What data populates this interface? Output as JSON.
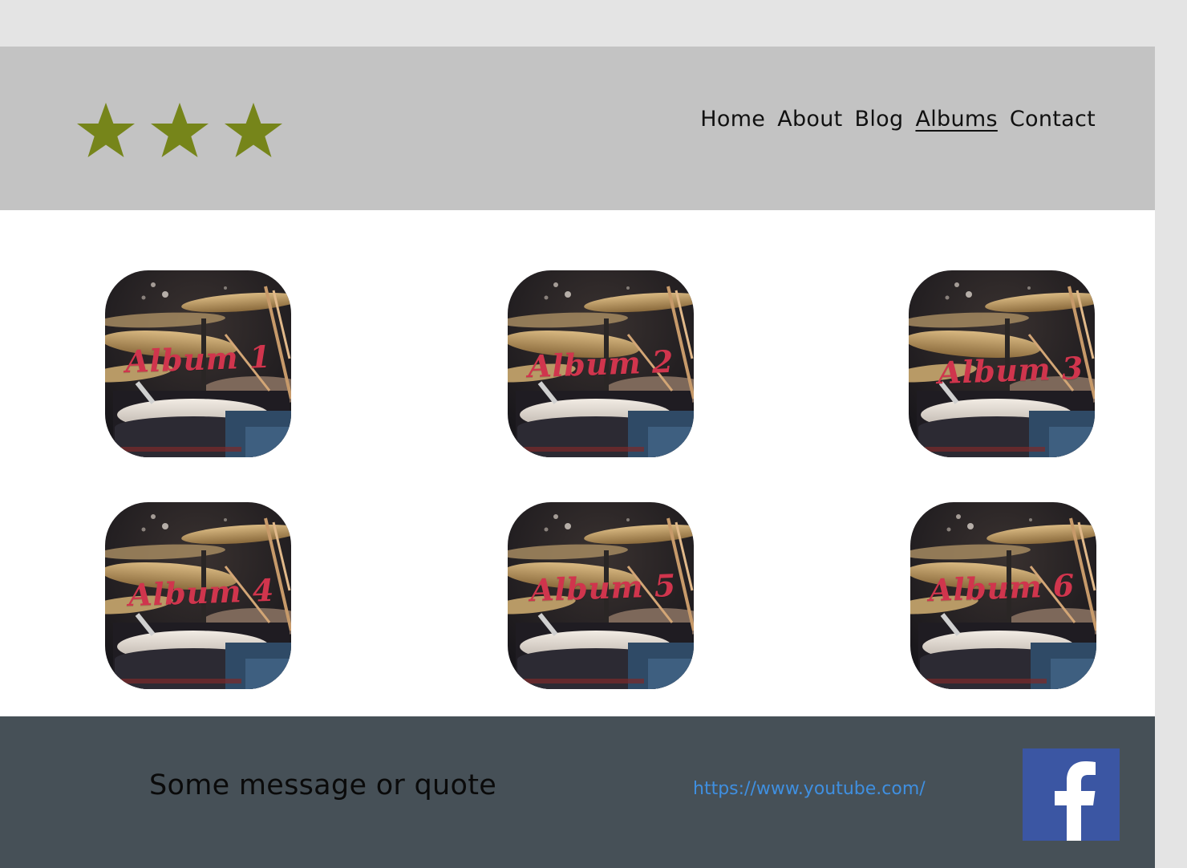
{
  "header": {
    "logo": {
      "stars": 3,
      "icon": "star-icon",
      "color": "#76851a"
    },
    "nav": [
      {
        "label": "Home",
        "active": false
      },
      {
        "label": "About",
        "active": false
      },
      {
        "label": "Blog",
        "active": false
      },
      {
        "label": "Albums",
        "active": true
      },
      {
        "label": "Contact",
        "active": false
      }
    ]
  },
  "albums": [
    {
      "title": "Album 1",
      "image": "drum-kit-photo"
    },
    {
      "title": "Album 2",
      "image": "drum-kit-photo"
    },
    {
      "title": "Album 3",
      "image": "drum-kit-photo"
    },
    {
      "title": "Album 4",
      "image": "drum-kit-photo"
    },
    {
      "title": "Album 5",
      "image": "drum-kit-photo"
    },
    {
      "title": "Album 6",
      "image": "drum-kit-photo"
    }
  ],
  "footer": {
    "quote": "Some message or quote",
    "link_text": "https://www.youtube.com/",
    "social_icon": "facebook-icon",
    "social_color": "#3b56a3"
  },
  "colors": {
    "header_bg": "#c3c3c3",
    "footer_bg": "#465057",
    "album_title": "#d0354d",
    "link": "#3f8fe0"
  }
}
